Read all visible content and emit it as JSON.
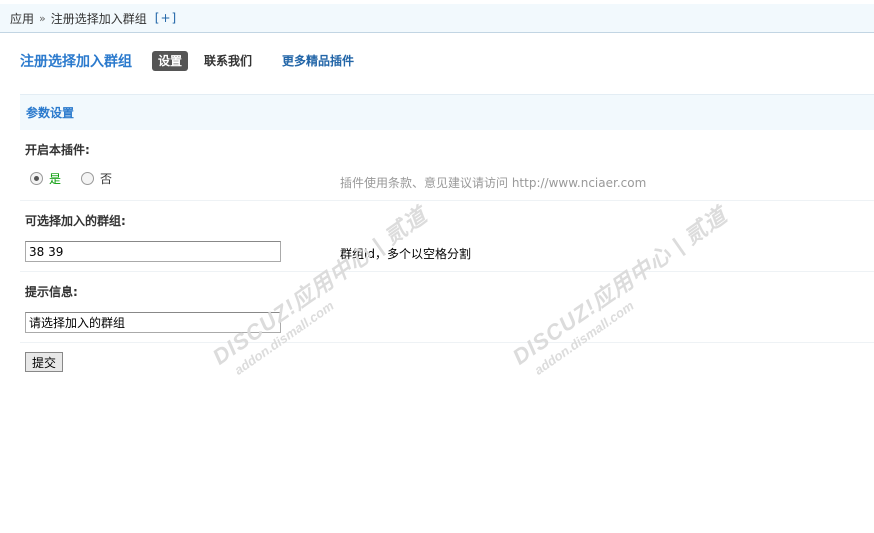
{
  "breadcrumb": {
    "root": "应用",
    "separator": "»",
    "current": "注册选择加入群组",
    "add": "[+]"
  },
  "tabs": {
    "plugin_title": "注册选择加入群组",
    "items": [
      {
        "label": "设置",
        "active": true
      },
      {
        "label": "联系我们",
        "active": false
      }
    ],
    "more_link": "更多精品插件"
  },
  "section": {
    "title": "参数设置"
  },
  "fields": {
    "enable": {
      "label": "开启本插件:",
      "options": [
        {
          "label": "是",
          "checked": true
        },
        {
          "label": "否",
          "checked": false
        }
      ],
      "hint": "插件使用条款、意见建议请访问 http://www.nciaer.com"
    },
    "groups": {
      "label": "可选择加入的群组:",
      "value": "38 39",
      "hint": "群组id，多个以空格分割"
    },
    "message": {
      "label": "提示信息:",
      "value": "请选择加入的群组"
    }
  },
  "submit_label": "提交",
  "watermarks": [
    {
      "brand": "DISCUZ!应用中心 | 贰道",
      "domain": "addon.dismall.com"
    },
    {
      "brand": "DISCUZ!应用中心 | 贰道",
      "domain": "addon.dismall.com"
    }
  ]
}
